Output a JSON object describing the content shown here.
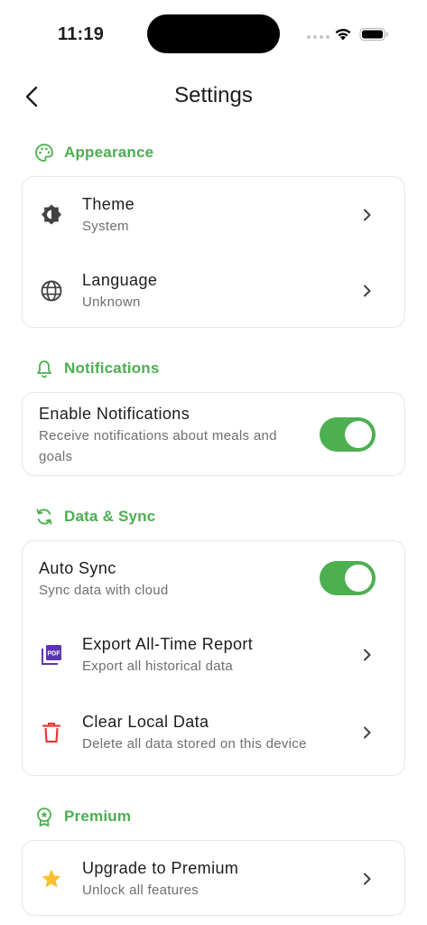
{
  "status_bar": {
    "time": "11:19"
  },
  "header": {
    "title": "Settings"
  },
  "sections": {
    "appearance": {
      "title": "Appearance",
      "theme": {
        "title": "Theme",
        "subtitle": "System"
      },
      "language": {
        "title": "Language",
        "subtitle": "Unknown"
      }
    },
    "notifications": {
      "title": "Notifications",
      "enable": {
        "title": "Enable Notifications",
        "subtitle": "Receive notifications about meals and goals",
        "enabled": true
      }
    },
    "data_sync": {
      "title": "Data & Sync",
      "auto_sync": {
        "title": "Auto Sync",
        "subtitle": "Sync data with cloud",
        "enabled": true
      },
      "export": {
        "title": "Export All-Time Report",
        "subtitle": "Export all historical data"
      },
      "clear": {
        "title": "Clear Local Data",
        "subtitle": "Delete all data stored on this device"
      }
    },
    "premium": {
      "title": "Premium",
      "upgrade": {
        "title": "Upgrade to Premium",
        "subtitle": "Unlock all features"
      }
    }
  },
  "colors": {
    "accent": "#4caf50",
    "danger": "#e53935",
    "pdf": "#5e35b1",
    "star": "#fbc02d"
  }
}
